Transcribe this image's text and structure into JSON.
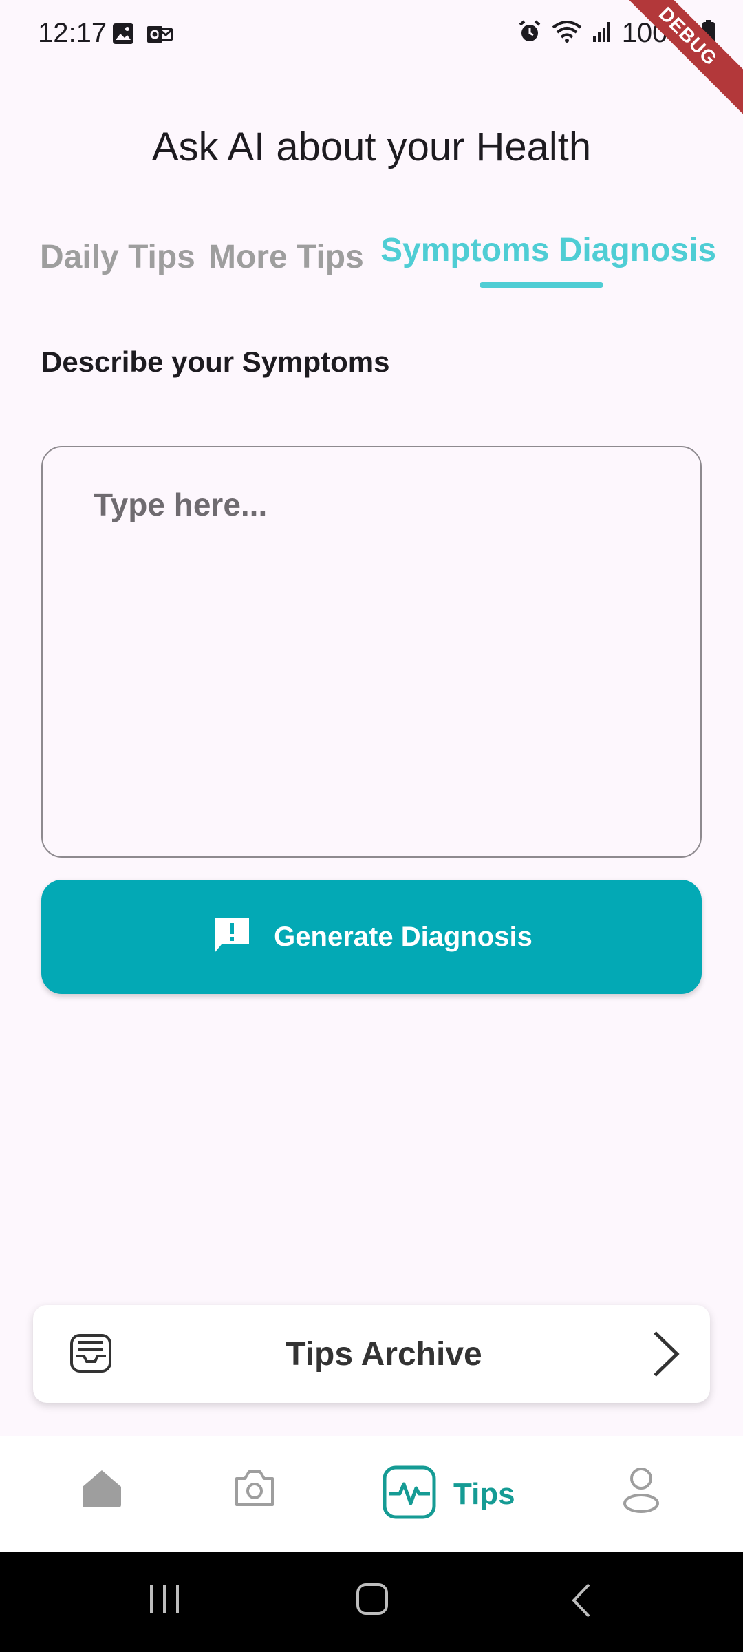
{
  "status_bar": {
    "time": "12:17",
    "battery": "100%",
    "debug_label": "DEBUG"
  },
  "page": {
    "title": "Ask AI about your Health"
  },
  "tabs": [
    {
      "label": "Daily Tips",
      "active": false
    },
    {
      "label": "More Tips",
      "active": false
    },
    {
      "label": "Symptoms Diagnosis",
      "active": true
    }
  ],
  "symptoms": {
    "label": "Describe your Symptoms",
    "placeholder": "Type here...",
    "value": "",
    "button_label": "Generate Diagnosis",
    "button_icon": "feedback-icon"
  },
  "archive": {
    "label": "Tips Archive",
    "icon": "archive-icon"
  },
  "bottom_nav": {
    "items": [
      {
        "icon": "home-icon",
        "label": ""
      },
      {
        "icon": "camera-icon",
        "label": ""
      },
      {
        "icon": "heart-monitor-icon",
        "label": "Tips",
        "active": true
      },
      {
        "icon": "profile-icon",
        "label": ""
      }
    ]
  },
  "colors": {
    "accent": "#03a9b5",
    "active_tab": "#4fcdd4",
    "nav_active": "#159b94",
    "background": "#fdf7fd"
  }
}
